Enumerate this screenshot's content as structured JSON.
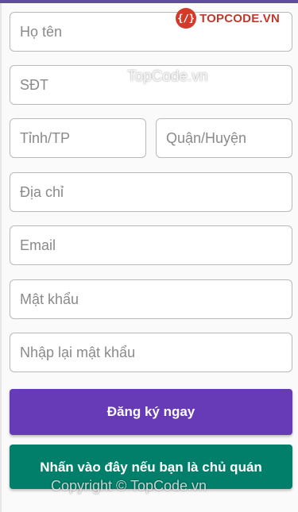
{
  "form": {
    "full_name_placeholder": "Họ tên",
    "phone_placeholder": "SĐT",
    "province_placeholder": "Tỉnh/TP",
    "district_placeholder": "Quận/Huyện",
    "address_placeholder": "Địa chỉ",
    "email_placeholder": "Email",
    "password_placeholder": "Mật khẩu",
    "confirm_password_placeholder": "Nhập lại mật khẩu"
  },
  "buttons": {
    "register_label": "Đăng ký ngay",
    "owner_label": "Nhấn vào đây nếu bạn là chủ quán"
  },
  "watermarks": {
    "logo_text": "TOPCODE.VN",
    "logo_icon_glyph": "{/}",
    "center_text": "TopCode.vn",
    "copyright_text": "Copyright © TopCode.vn"
  },
  "colors": {
    "primary": "#673ab7",
    "secondary": "#017f6a",
    "top_strip": "#5e4e9c",
    "logo_red": "#d43a2a"
  }
}
